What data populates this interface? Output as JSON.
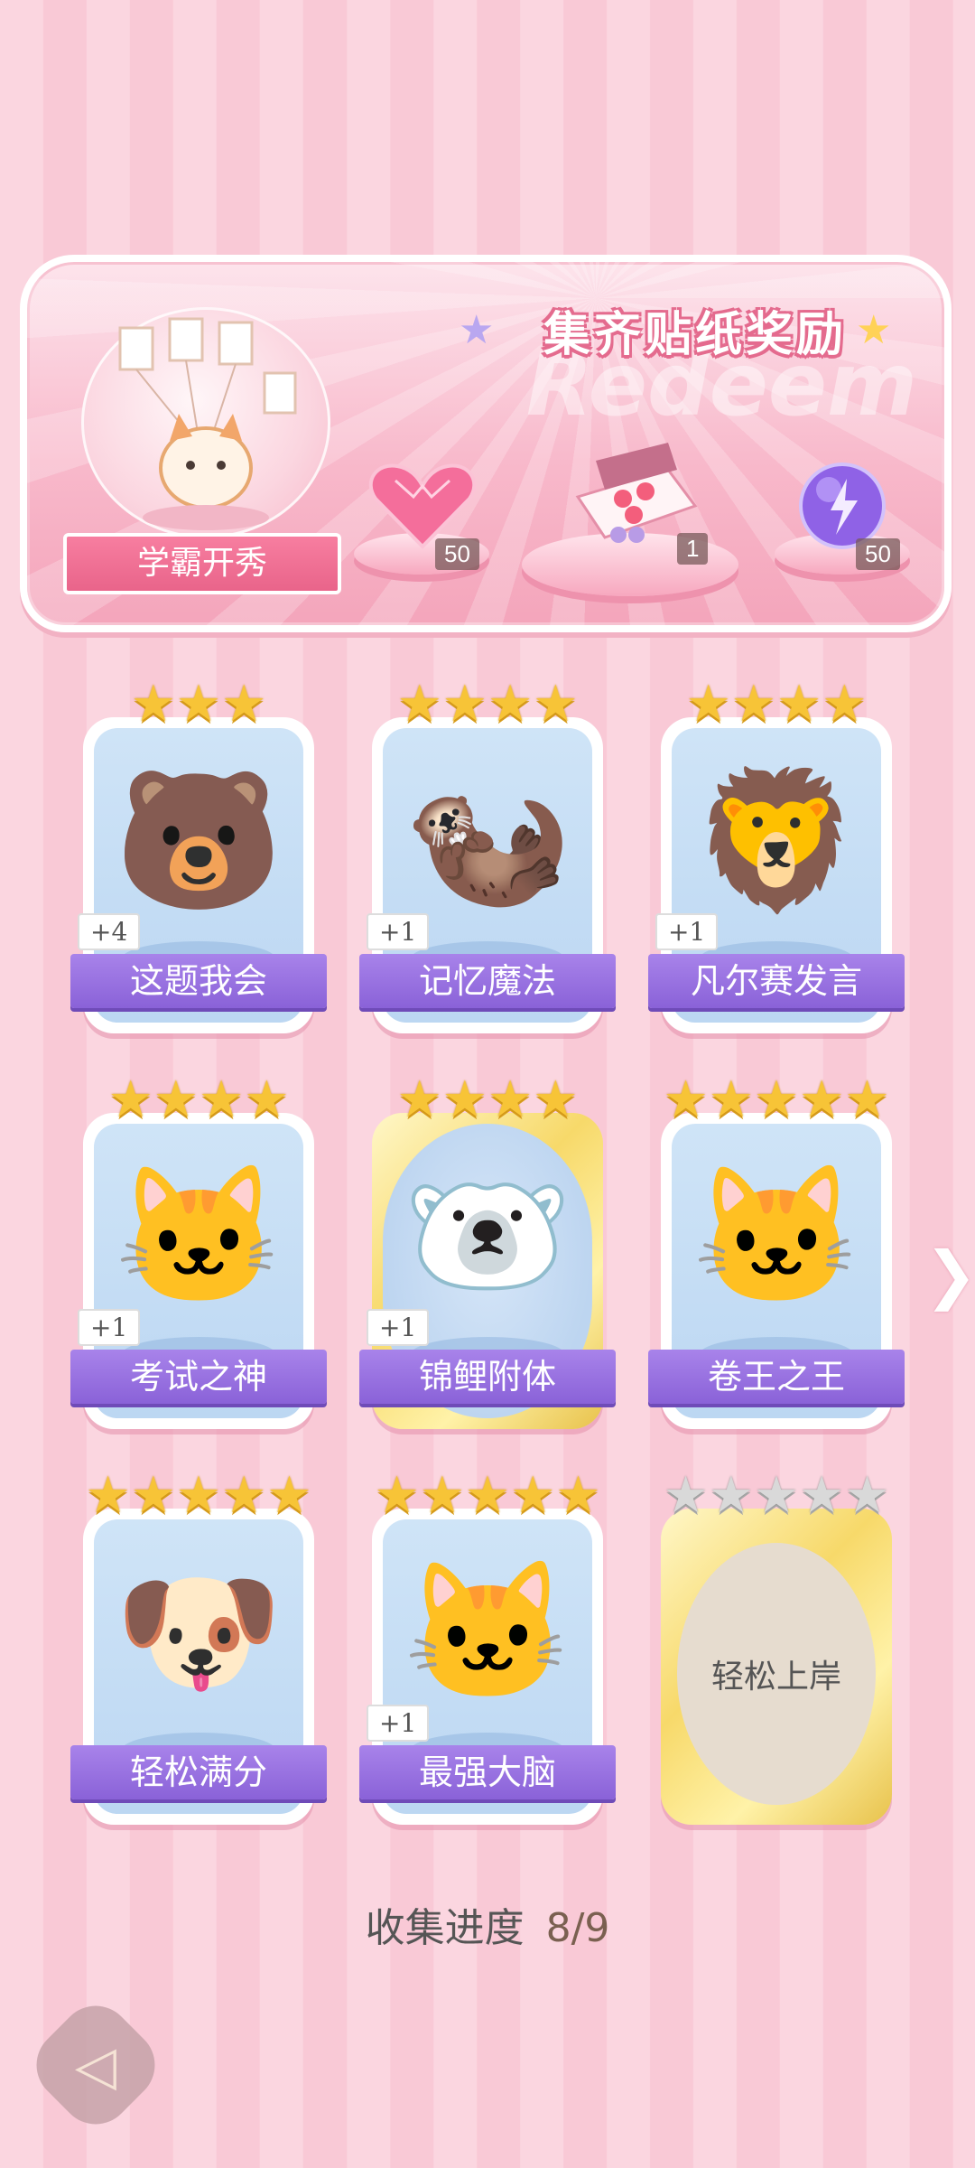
{
  "banner": {
    "title": "集齐贴纸奖励",
    "watermark": "Redeem",
    "feature_label": "学霸开秀",
    "rewards": [
      {
        "icon": "pink-diamond-heart-icon",
        "count": "50"
      },
      {
        "icon": "gift-box-icon",
        "count": "1"
      },
      {
        "icon": "lightning-orb-icon",
        "count": "50"
      }
    ]
  },
  "stickers": [
    {
      "name": "这题我会",
      "plus": "+4",
      "stars": 3,
      "char": "🐻",
      "collected": true
    },
    {
      "name": "记忆魔法",
      "plus": "+1",
      "stars": 4,
      "char": "🦦",
      "collected": true
    },
    {
      "name": "凡尔赛发言",
      "plus": "+1",
      "stars": 4,
      "char": "🦁",
      "collected": true
    },
    {
      "name": "考试之神",
      "plus": "+1",
      "stars": 4,
      "char": "🐱",
      "collected": true
    },
    {
      "name": "锦鲤附体",
      "plus": "+1",
      "stars": 4,
      "char": "🐻‍❄️",
      "collected": true,
      "gold": true
    },
    {
      "name": "卷王之王",
      "plus": "",
      "stars": 5,
      "char": "🐱",
      "collected": true
    },
    {
      "name": "轻松满分",
      "plus": "",
      "stars": 5,
      "char": "🐶",
      "collected": true
    },
    {
      "name": "最强大脑",
      "plus": "+1",
      "stars": 5,
      "char": "🐱",
      "collected": true
    },
    {
      "name": "轻松上岸",
      "plus": "",
      "stars": 5,
      "char": "",
      "collected": false
    }
  ],
  "progress": {
    "label": "收集进度",
    "value": "8/9"
  },
  "nav": {
    "next_icon": "chevron-right-icon",
    "back_icon": "back-arrow-icon"
  }
}
